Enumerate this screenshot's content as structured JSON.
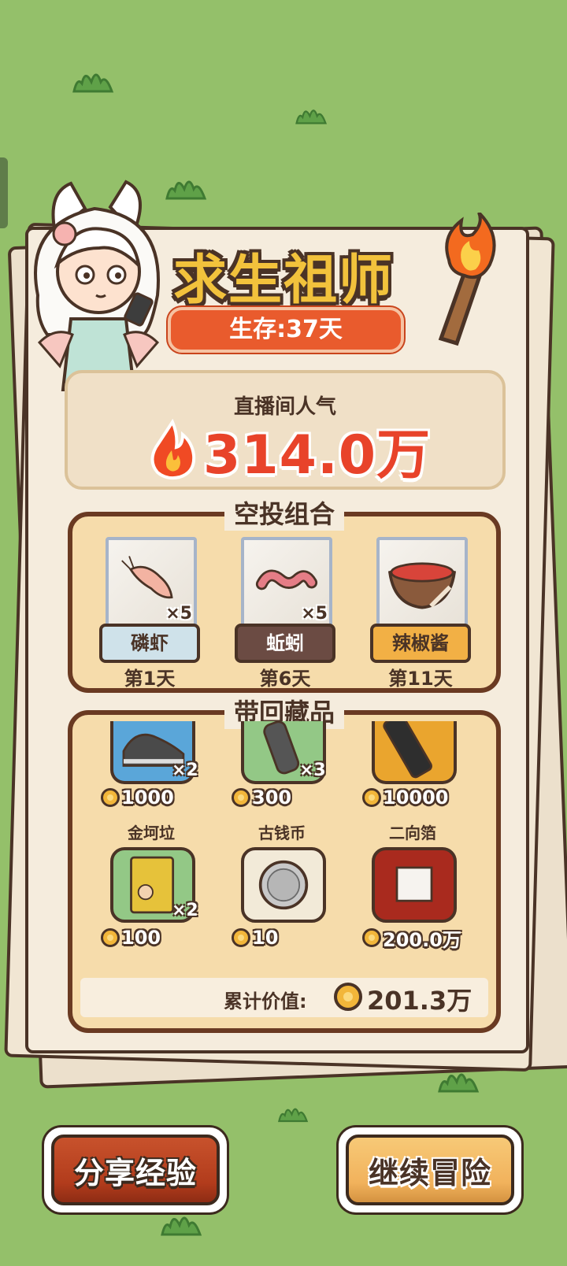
{
  "title": "求生祖师",
  "survival": "生存:37天",
  "popularity": {
    "label": "直播间人气",
    "value": "314.0万"
  },
  "airdrop": {
    "title": "空投组合",
    "items": [
      {
        "name": "磷虾",
        "qty": "×5",
        "day": "第1天",
        "label_color": "#cfe2ea",
        "text_color": "#4a3326",
        "icon": "krill-icon"
      },
      {
        "name": "蚯蚓",
        "qty": "×5",
        "day": "第6天",
        "label_color": "#6b4b43",
        "text_color": "#ffffff",
        "icon": "worm-icon"
      },
      {
        "name": "辣椒酱",
        "qty": "",
        "day": "第11天",
        "label_color": "#f2b045",
        "text_color": "#4a3326",
        "icon": "chili-sauce-bowl-icon"
      }
    ]
  },
  "collection": {
    "title": "带回藏品",
    "items": [
      {
        "name": "",
        "qty": "×2",
        "price": "1000",
        "card_color": "#5aa6d9",
        "icon": "sneaker-icon"
      },
      {
        "name": "",
        "qty": "×3",
        "price": "300",
        "card_color": "#93c886",
        "icon": "remote-icon"
      },
      {
        "name": "",
        "qty": "",
        "price": "10000",
        "card_color": "#eaa52e",
        "icon": "phone-icon"
      },
      {
        "name": "金坷垃",
        "qty": "×2",
        "price": "100",
        "card_color": "#93c886",
        "icon": "fertilizer-bag-icon"
      },
      {
        "name": "古钱币",
        "qty": "",
        "price": "10",
        "card_color": "#f2ead8",
        "icon": "ancient-coin-icon"
      },
      {
        "name": "二向箔",
        "qty": "",
        "price": "200.0万",
        "card_color": "#a92a1e",
        "icon": "dual-vector-foil-icon"
      }
    ],
    "total_label": "累计价值:",
    "total_value": "201.3万"
  },
  "buttons": {
    "share": "分享经验",
    "continue": "继续冒险"
  }
}
